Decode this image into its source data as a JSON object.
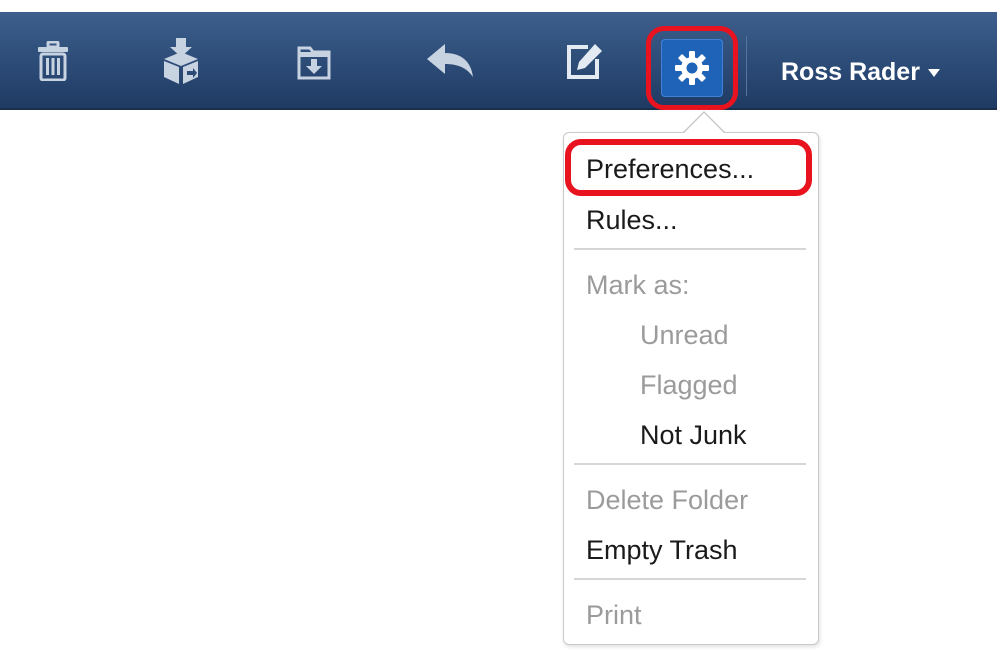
{
  "toolbar": {
    "buttons": [
      {
        "icon": "trash-icon"
      },
      {
        "icon": "move-to-icon"
      },
      {
        "icon": "archive-folder-icon"
      },
      {
        "icon": "reply-icon"
      },
      {
        "icon": "compose-icon"
      },
      {
        "icon": "gear-icon"
      }
    ],
    "user_name": "Ross Rader",
    "colors": {
      "bar": "#2c4b77",
      "active": "#1e63b8",
      "highlight": "#e8131f"
    }
  },
  "settings_menu": {
    "preferences": "Preferences...",
    "rules": "Rules...",
    "mark_as": "Mark as:",
    "unread": "Unread",
    "flagged": "Flagged",
    "not_junk": "Not Junk",
    "delete_folder": "Delete Folder",
    "empty_trash": "Empty Trash",
    "print": "Print"
  }
}
